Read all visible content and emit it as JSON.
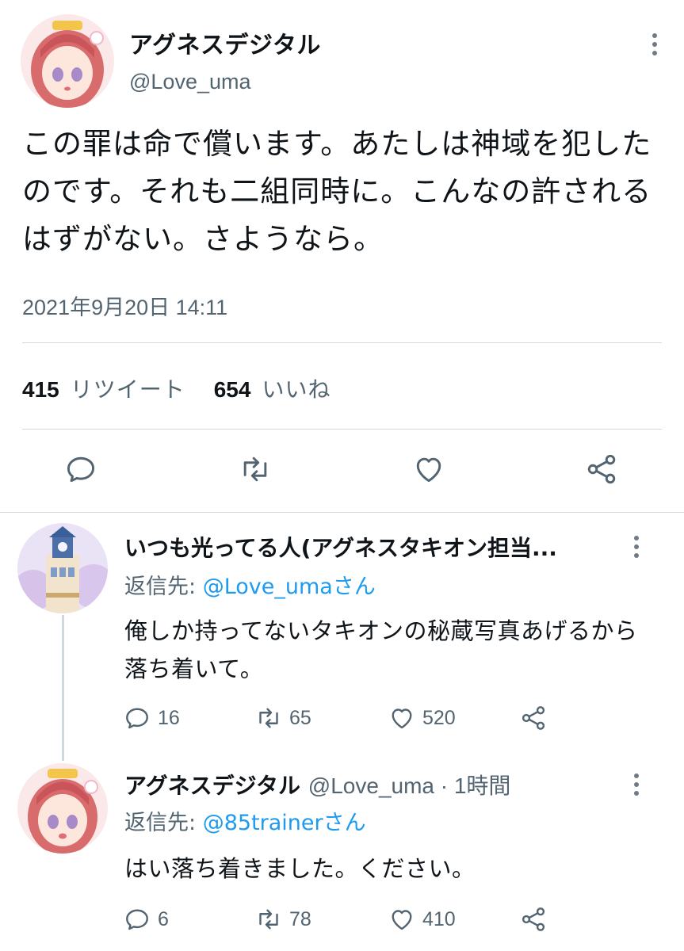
{
  "main_tweet": {
    "author_name": "アグネスデジタル",
    "author_handle": "@Love_uma",
    "text": "この罪は命で償います。あたしは神域を犯したのです。それも二組同時に。こんなの許されるはずがない。さようなら。",
    "timestamp": "2021年9月20日 14:11",
    "retweet_count": "415",
    "retweet_label": "リツイート",
    "like_count": "654",
    "like_label": "いいね",
    "actions": [
      "reply-icon",
      "retweet-icon",
      "like-icon",
      "share-icon"
    ]
  },
  "replies": [
    {
      "author_name": "いつも光ってる人(アグネスタキオン担当...",
      "reply_to_prefix": "返信先: ",
      "reply_to_mention": "@Love_umaさん",
      "text": "俺しか持ってないタキオンの秘蔵写真あげるから落ち着いて。",
      "reply_count": "16",
      "retweet_count": "65",
      "like_count": "520"
    },
    {
      "author_name": "アグネスデジタル",
      "author_handle_time": "@Love_uma · 1時間",
      "reply_to_prefix": "返信先: ",
      "reply_to_mention": "@85trainerさん",
      "text": "はい落ち着きました。ください。",
      "reply_count": "6",
      "retweet_count": "78",
      "like_count": "410"
    }
  ],
  "colors": {
    "text_primary": "#0f1419",
    "text_secondary": "#536471",
    "link": "#1d9bf0",
    "divider": "#cfd9de"
  }
}
